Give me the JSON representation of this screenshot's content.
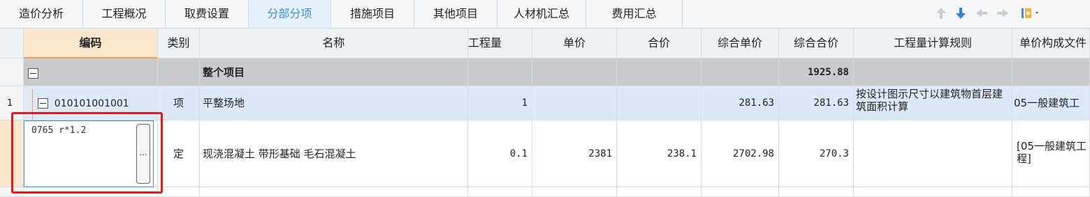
{
  "tabs": [
    {
      "label": "造价分析",
      "active": false
    },
    {
      "label": "工程概况",
      "active": false
    },
    {
      "label": "取费设置",
      "active": false
    },
    {
      "label": "分部分项",
      "active": true
    },
    {
      "label": "措施项目",
      "active": false
    },
    {
      "label": "其他项目",
      "active": false
    },
    {
      "label": "人材机汇总",
      "active": false
    },
    {
      "label": "费用汇总",
      "active": false
    }
  ],
  "toolbar_icons": [
    "arrow-up-icon",
    "arrow-down-icon",
    "arrow-left-icon",
    "arrow-right-icon",
    "settings-menu-icon"
  ],
  "columns": [
    "编码",
    "类别",
    "名称",
    "工程量",
    "单价",
    "合价",
    "综合单价",
    "综合合价",
    "工程量计算规则",
    "单价构成文件"
  ],
  "rows": [
    {
      "num": "",
      "code": "",
      "type": "",
      "name": "整个项目",
      "qty": "",
      "price": "",
      "total": "",
      "unit_price": "",
      "sum_price": "1925.88",
      "rule": "",
      "file": ""
    },
    {
      "num": "1",
      "code": "010101001001",
      "type": "项",
      "name": "平整场地",
      "qty": "1",
      "price": "",
      "total": "",
      "unit_price": "281.63",
      "sum_price": "281.63",
      "rule": "按设计图示尺寸以建筑物首层建筑面积计算",
      "file": "05一般建筑工"
    },
    {
      "num": "",
      "code": "0765 r*1.2",
      "type": "定",
      "name": "现浇混凝土 带形基础 毛石混凝土",
      "qty": "0.1",
      "price": "2381",
      "total": "238.1",
      "unit_price": "2702.98",
      "sum_price": "270.3",
      "rule": "",
      "file": "[05一般建筑工程]"
    }
  ],
  "editor": {
    "value": "0765 r*1.2",
    "button": "..."
  },
  "colors": {
    "accent": "#3b8fde",
    "highlight_box": "#e31b1b",
    "selected_header": "#fbe6cf"
  }
}
